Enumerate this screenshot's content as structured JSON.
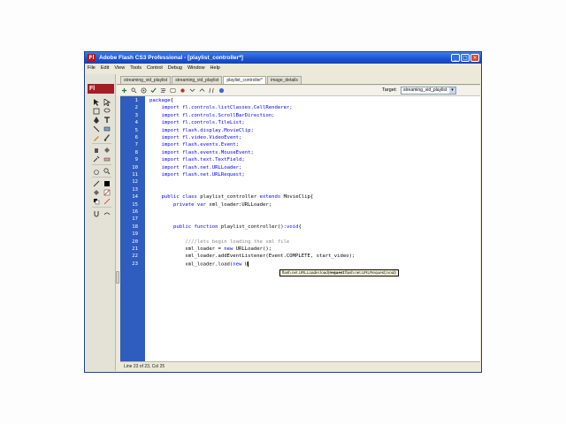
{
  "window": {
    "title": "Adobe Flash CS3 Professional - [playlist_controller*]",
    "icon_label": "Fl"
  },
  "menu": [
    "File",
    "Edit",
    "View",
    "Tools",
    "Control",
    "Debug",
    "Window",
    "Help"
  ],
  "tools_panel": {
    "logo": "Fl"
  },
  "tabs": [
    {
      "label": "streaming_vid_playlist",
      "active": false
    },
    {
      "label": "streaming_vid_playlist",
      "active": false
    },
    {
      "label": "playlist_controller*",
      "active": true
    },
    {
      "label": "image_details",
      "active": false
    }
  ],
  "editor_toolbar": {
    "target_label": "Target:",
    "target_value": "streaming_vid_playlist"
  },
  "code": {
    "lines": [
      {
        "n": "1",
        "text": "package{"
      },
      {
        "n": "2",
        "text": "    import fl.controls.listClasses.CellRenderer;"
      },
      {
        "n": "3",
        "text": "    import fl.controls.ScrollBarDirection;"
      },
      {
        "n": "4",
        "text": "    import fl.controls.TileList;"
      },
      {
        "n": "5",
        "text": "    import flash.display.MovieClip;"
      },
      {
        "n": "6",
        "text": "    import fl.video.VideoEvent;"
      },
      {
        "n": "7",
        "text": "    import flash.events.Event;"
      },
      {
        "n": "8",
        "text": "    import flash.events.MouseEvent;"
      },
      {
        "n": "9",
        "text": "    import flash.text.TextField;"
      },
      {
        "n": "10",
        "text": "    import flash.net.URLLoader;"
      },
      {
        "n": "11",
        "text": "    import flash.net.URLRequest;"
      },
      {
        "n": "12",
        "text": ""
      },
      {
        "n": "13",
        "text": ""
      },
      {
        "n": "14",
        "text": "    public class playlist_controller extends MovieClip{"
      },
      {
        "n": "15",
        "text": "        private var xml_loader:URLLoader;"
      },
      {
        "n": "16",
        "text": ""
      },
      {
        "n": "17",
        "text": ""
      },
      {
        "n": "18",
        "text": "        public function playlist_controller():void{"
      },
      {
        "n": "19",
        "text": ""
      },
      {
        "n": "20",
        "text": "            ////lets begin loading the xml file"
      },
      {
        "n": "21",
        "text": "            xml_loader = new URLLoader();"
      },
      {
        "n": "22",
        "text": "            xml_loader.addEventListener(Event.COMPLETE, start_video);"
      },
      {
        "n": "23",
        "text": "            xml_loader.load(new U"
      }
    ],
    "tooltip_prefix": "flash.net.URLLoader.load(",
    "tooltip_bold": "request",
    "tooltip_suffix": ":flash.net.URLRequest):void)"
  },
  "status": {
    "text": "Line 23 of 23, Col 25"
  },
  "colors": {
    "gutter": "#2f5cbf",
    "keyword": "#0000ff",
    "comment": "#888888",
    "titlebar": "#1b52d1"
  }
}
